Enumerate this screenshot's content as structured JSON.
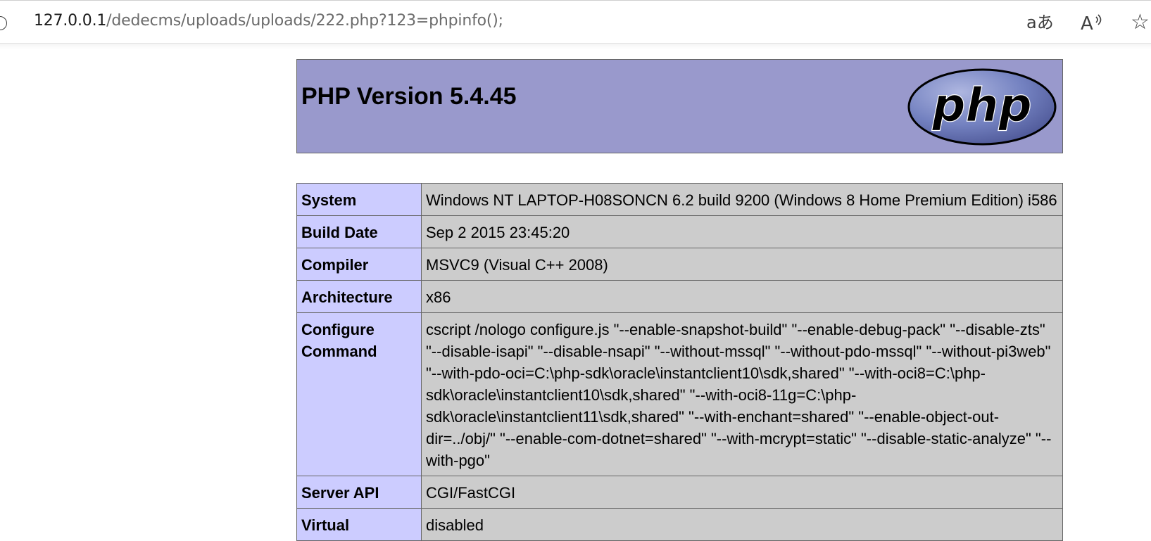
{
  "browser": {
    "url_host": "127.0.0.1",
    "url_path": "/dedecms/uploads/uploads/222.php?123=phpinfo();",
    "icons": {
      "site_info": "info-icon",
      "translate": "translate-icon",
      "read_aloud": "read-aloud-icon",
      "favorite": "star-icon"
    },
    "icon_glyphs": {
      "translate": "aあ",
      "read_aloud": "A",
      "favorite": "☆"
    }
  },
  "phpinfo": {
    "title": "PHP Version 5.4.45",
    "logo_text": "php",
    "colors": {
      "header_bg": "#9999cc",
      "key_bg": "#ccccff",
      "value_bg": "#cccccc",
      "border": "#666666",
      "logo_fill": "#6c7eb7"
    },
    "rows": [
      {
        "key": "System",
        "value": "Windows NT LAPTOP-H08SONCN 6.2 build 9200 (Windows 8 Home Premium Edition) i586"
      },
      {
        "key": "Build Date",
        "value": "Sep 2 2015 23:45:20"
      },
      {
        "key": "Compiler",
        "value": "MSVC9 (Visual C++ 2008)"
      },
      {
        "key": "Architecture",
        "value": "x86"
      },
      {
        "key": "Configure Command",
        "value": "cscript /nologo configure.js \"--enable-snapshot-build\" \"--enable-debug-pack\" \"--disable-zts\" \"--disable-isapi\" \"--disable-nsapi\" \"--without-mssql\" \"--without-pdo-mssql\" \"--without-pi3web\" \"--with-pdo-oci=C:\\php-sdk\\oracle\\instantclient10\\sdk,shared\" \"--with-oci8=C:\\php-sdk\\oracle\\instantclient10\\sdk,shared\" \"--with-oci8-11g=C:\\php-sdk\\oracle\\instantclient11\\sdk,shared\" \"--with-enchant=shared\" \"--enable-object-out-dir=../obj/\" \"--enable-com-dotnet=shared\" \"--with-mcrypt=static\" \"--disable-static-analyze\" \"--with-pgo\""
      },
      {
        "key": "Server API",
        "value": "CGI/FastCGI"
      },
      {
        "key": "Virtual",
        "value": "disabled"
      }
    ]
  }
}
